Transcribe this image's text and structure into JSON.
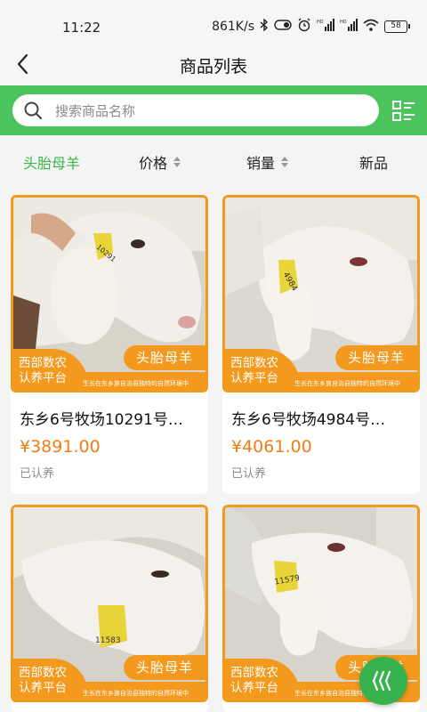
{
  "status_bar": {
    "time": "11:22",
    "net_speed": "861K/s",
    "battery": "58",
    "icons": [
      "bluetooth-icon",
      "toggle-icon",
      "alarm-icon",
      "signal-hd-icon",
      "signal-hd-icon",
      "wifi-icon",
      "battery-icon"
    ]
  },
  "header": {
    "title": "商品列表"
  },
  "search": {
    "placeholder": "搜索商品名称"
  },
  "sort_tabs": [
    {
      "label": "头胎母羊",
      "active": true
    },
    {
      "label": "价格",
      "sortable": true
    },
    {
      "label": "销量",
      "sortable": true
    },
    {
      "label": "新品"
    }
  ],
  "products": [
    {
      "name": "东乡6号牧场10291号…",
      "price": "¥3891.00",
      "status": "已认养",
      "ear_tag": "10291",
      "breed_tag": "头胎母羊",
      "platform_line1": "西部数农",
      "platform_line2": "认养平台",
      "slogan": "生长在东乡族自治县独特的自然环境中"
    },
    {
      "name": "东乡6号牧场4984号…",
      "price": "¥4061.00",
      "status": "已认养",
      "ear_tag": "4984",
      "breed_tag": "头胎母羊",
      "platform_line1": "西部数农",
      "platform_line2": "认养平台",
      "slogan": "生长在东乡族自治县独特的自然环境中"
    },
    {
      "ear_tag": "11583",
      "breed_tag": "头胎母羊",
      "platform_line1": "西部数农",
      "platform_line2": "认养平台",
      "slogan": "生长在东乡族自治县独特的自然环境中"
    },
    {
      "ear_tag": "11579",
      "breed_tag": "头胎母羊",
      "platform_line1": "西部数农",
      "platform_line2": "认养平台",
      "slogan": "生长在东乡族自治县独特的自然环境中"
    }
  ],
  "colors": {
    "brand_green": "#4cc45e",
    "active_tab": "#3bb54a",
    "accent_orange": "#f39a1e",
    "price_orange": "#ef7d12"
  }
}
